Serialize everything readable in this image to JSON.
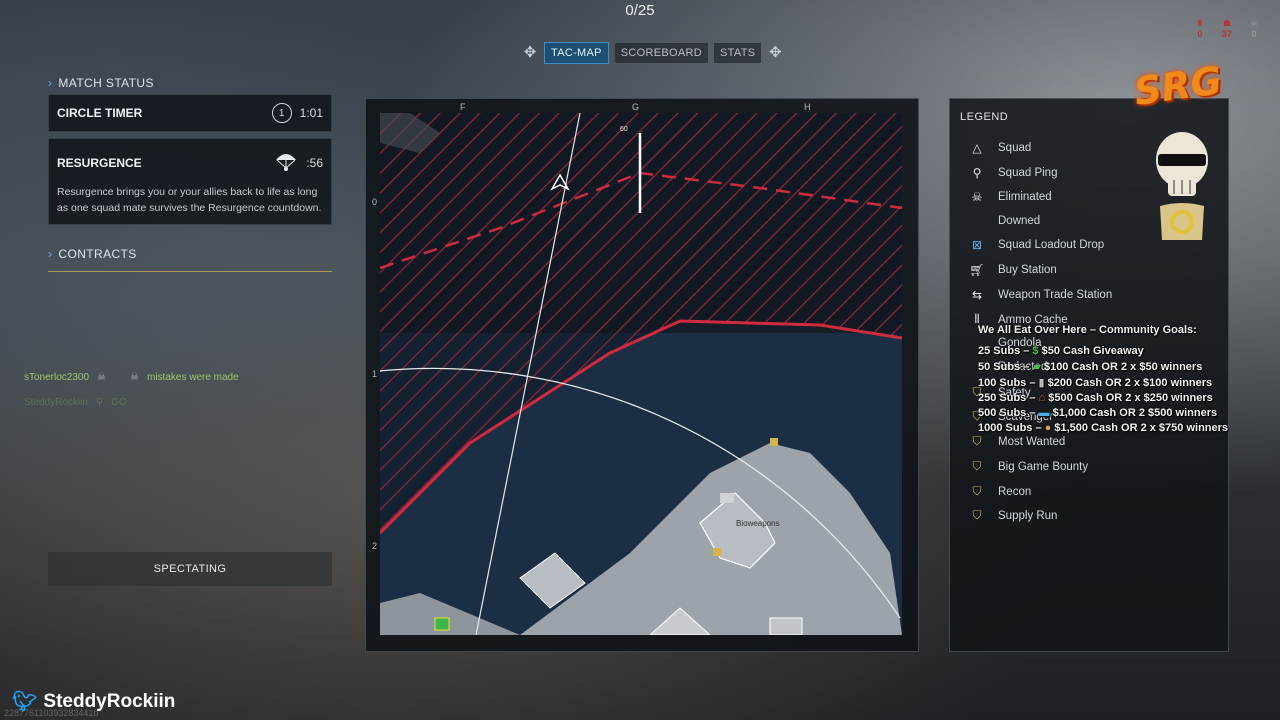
{
  "top": {
    "count": "0/25"
  },
  "tabs": [
    {
      "label": "TAC-MAP",
      "active": true
    },
    {
      "label": "SCOREBOARD",
      "active": false
    },
    {
      "label": "STATS",
      "active": false
    }
  ],
  "hud_stats": [
    {
      "value": "0"
    },
    {
      "value": "37"
    },
    {
      "value": "0"
    }
  ],
  "left_panel": {
    "match_status": "MATCH STATUS",
    "circle_timer": {
      "label": "CIRCLE TIMER",
      "number": "1",
      "time": "1:01"
    },
    "resurgence": {
      "title": "RESURGENCE",
      "time": ":56",
      "description": "Resurgence brings you or your allies back to life as long as one squad mate survives the Resurgence countdown."
    },
    "contracts": "CONTRACTS"
  },
  "chat": {
    "player": "sTonerloc2300",
    "message": "mistakes were made",
    "player2": "SteddyRockiin",
    "message2": "GO"
  },
  "spectating": "SPECTATING",
  "map": {
    "col_labels": [
      "F",
      "G",
      "H"
    ],
    "row_labels": [
      "0",
      "1",
      "2"
    ],
    "poi_label": "Bioweapons",
    "marker_label": "60"
  },
  "legend": {
    "title": "LEGEND",
    "items": [
      {
        "icon": "squad-icon",
        "label": "Squad"
      },
      {
        "icon": "squad-ping-icon",
        "label": "Squad Ping"
      },
      {
        "icon": "eliminated-icon",
        "label": "Eliminated"
      },
      {
        "icon": "downed-icon",
        "label": "Downed"
      },
      {
        "icon": "loadout-drop-icon",
        "label": "Squad Loadout Drop"
      },
      {
        "icon": "buy-station-icon",
        "label": "Buy Station"
      },
      {
        "icon": "weapon-trade-icon",
        "label": "Weapon Trade Station"
      },
      {
        "icon": "ammo-cache-icon",
        "label": "Ammo Cache"
      },
      {
        "icon": "gondola-icon",
        "label": "Gondola"
      },
      {
        "icon": "redacted-icon",
        "label": "Redacted"
      },
      {
        "icon": "safety-icon",
        "label": "Safety"
      },
      {
        "icon": "scavenger-icon",
        "label": "Scavenger"
      },
      {
        "icon": "most-wanted-icon",
        "label": "Most Wanted"
      },
      {
        "icon": "big-game-bounty-icon",
        "label": "Big Game Bounty"
      },
      {
        "icon": "recon-icon",
        "label": "Recon"
      },
      {
        "icon": "supply-run-icon",
        "label": "Supply Run"
      }
    ]
  },
  "overlay": {
    "logo": "SRG",
    "goals_title": "We All Eat Over Here – Community Goals:",
    "goals": [
      {
        "subs": "25 Subs –",
        "reward": "$50 Cash Giveaway"
      },
      {
        "subs": "50 Subs –",
        "reward": "$100 Cash OR 2 x $50 winners"
      },
      {
        "subs": "100 Subs –",
        "reward": "$200 Cash OR 2 x $100 winners"
      },
      {
        "subs": "250 Subs –",
        "reward": "$500 Cash OR 2 x $250 winners"
      },
      {
        "subs": "500 Subs –",
        "reward": "$1,000 Cash OR 2 $500 winners"
      },
      {
        "subs": "1000 Subs –",
        "reward": "$1,500 Cash OR 2 x $750 winners"
      }
    ],
    "twitter_handle": "SteddyRockiin",
    "stream_id": "228776110393283441b"
  },
  "colors": {
    "accent": "#3f8ec2",
    "danger": "#c8283c",
    "water": "#1b2e44",
    "gold": "#d6b44a"
  }
}
